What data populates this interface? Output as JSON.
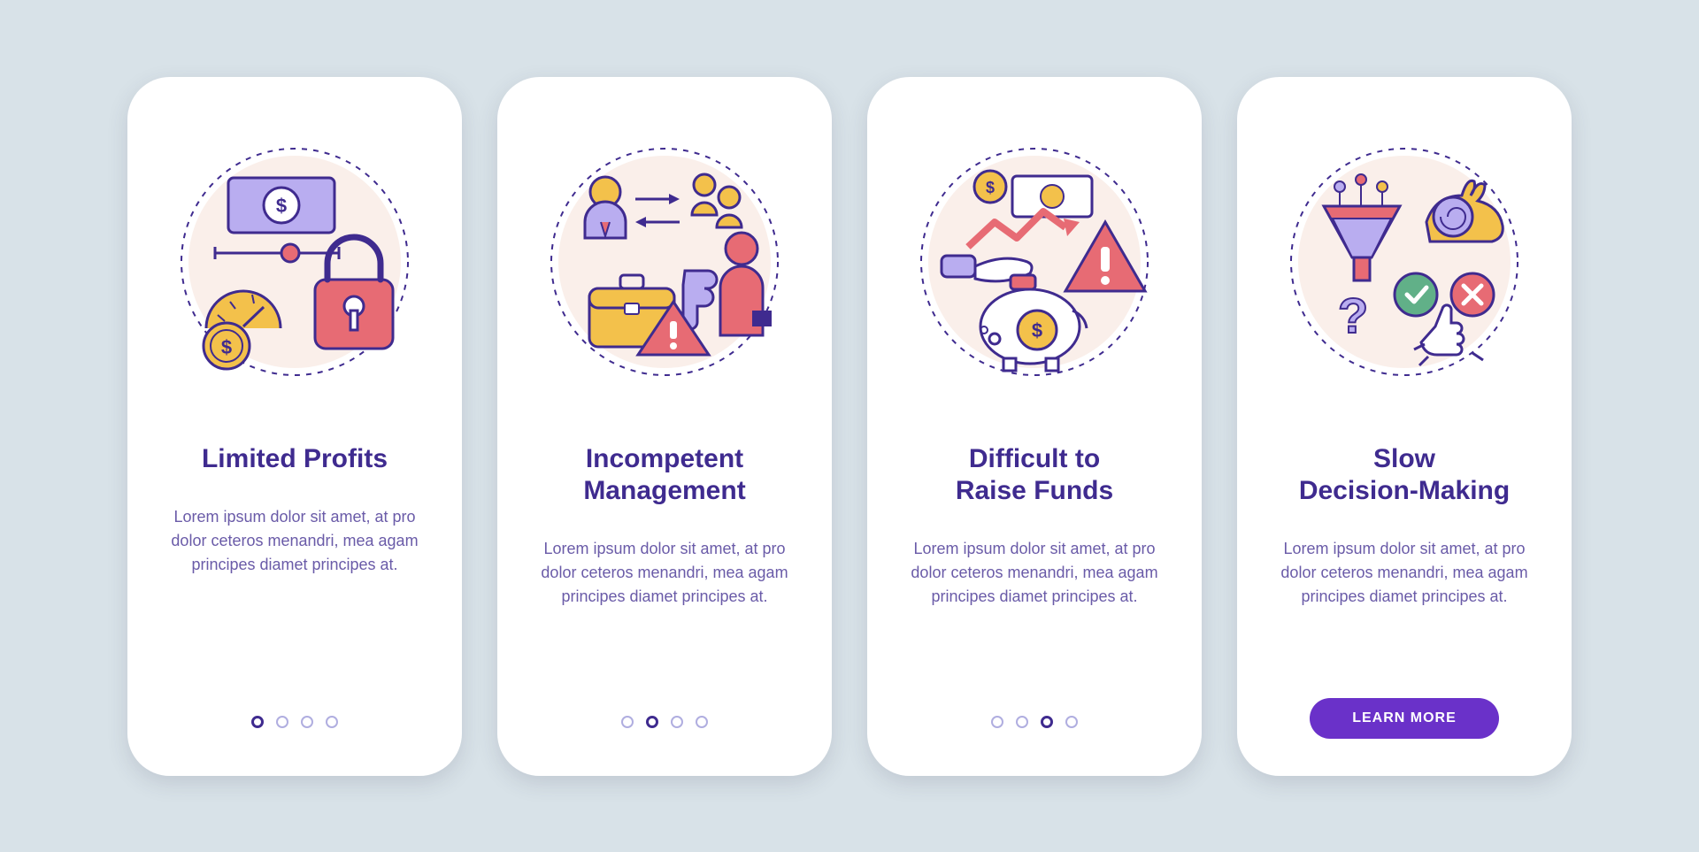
{
  "colors": {
    "stroke": "#3f2b8f",
    "red": "#e76b74",
    "yellow": "#f3c14b",
    "lavender": "#b9adf0",
    "white": "#ffffff",
    "green": "#61b088",
    "bg_circle": "#f2d0c4"
  },
  "cards": [
    {
      "title": "Limited Profits",
      "desc": "Lorem ipsum dolor sit amet, at pro dolor ceteros menandri, mea agam principes diamet principes at.",
      "active_dot": 0
    },
    {
      "title": "Incompetent\nManagement",
      "desc": "Lorem ipsum dolor sit amet, at pro dolor ceteros menandri, mea agam principes diamet principes at.",
      "active_dot": 1
    },
    {
      "title": "Difficult to\nRaise Funds",
      "desc": "Lorem ipsum dolor sit amet, at pro dolor ceteros menandri, mea agam principes diamet principes at.",
      "active_dot": 2
    },
    {
      "title": "Slow\nDecision-Making",
      "desc": "Lorem ipsum dolor sit amet, at pro dolor ceteros menandri, mea agam principes diamet principes at.",
      "cta": "LEARN MORE"
    }
  ]
}
